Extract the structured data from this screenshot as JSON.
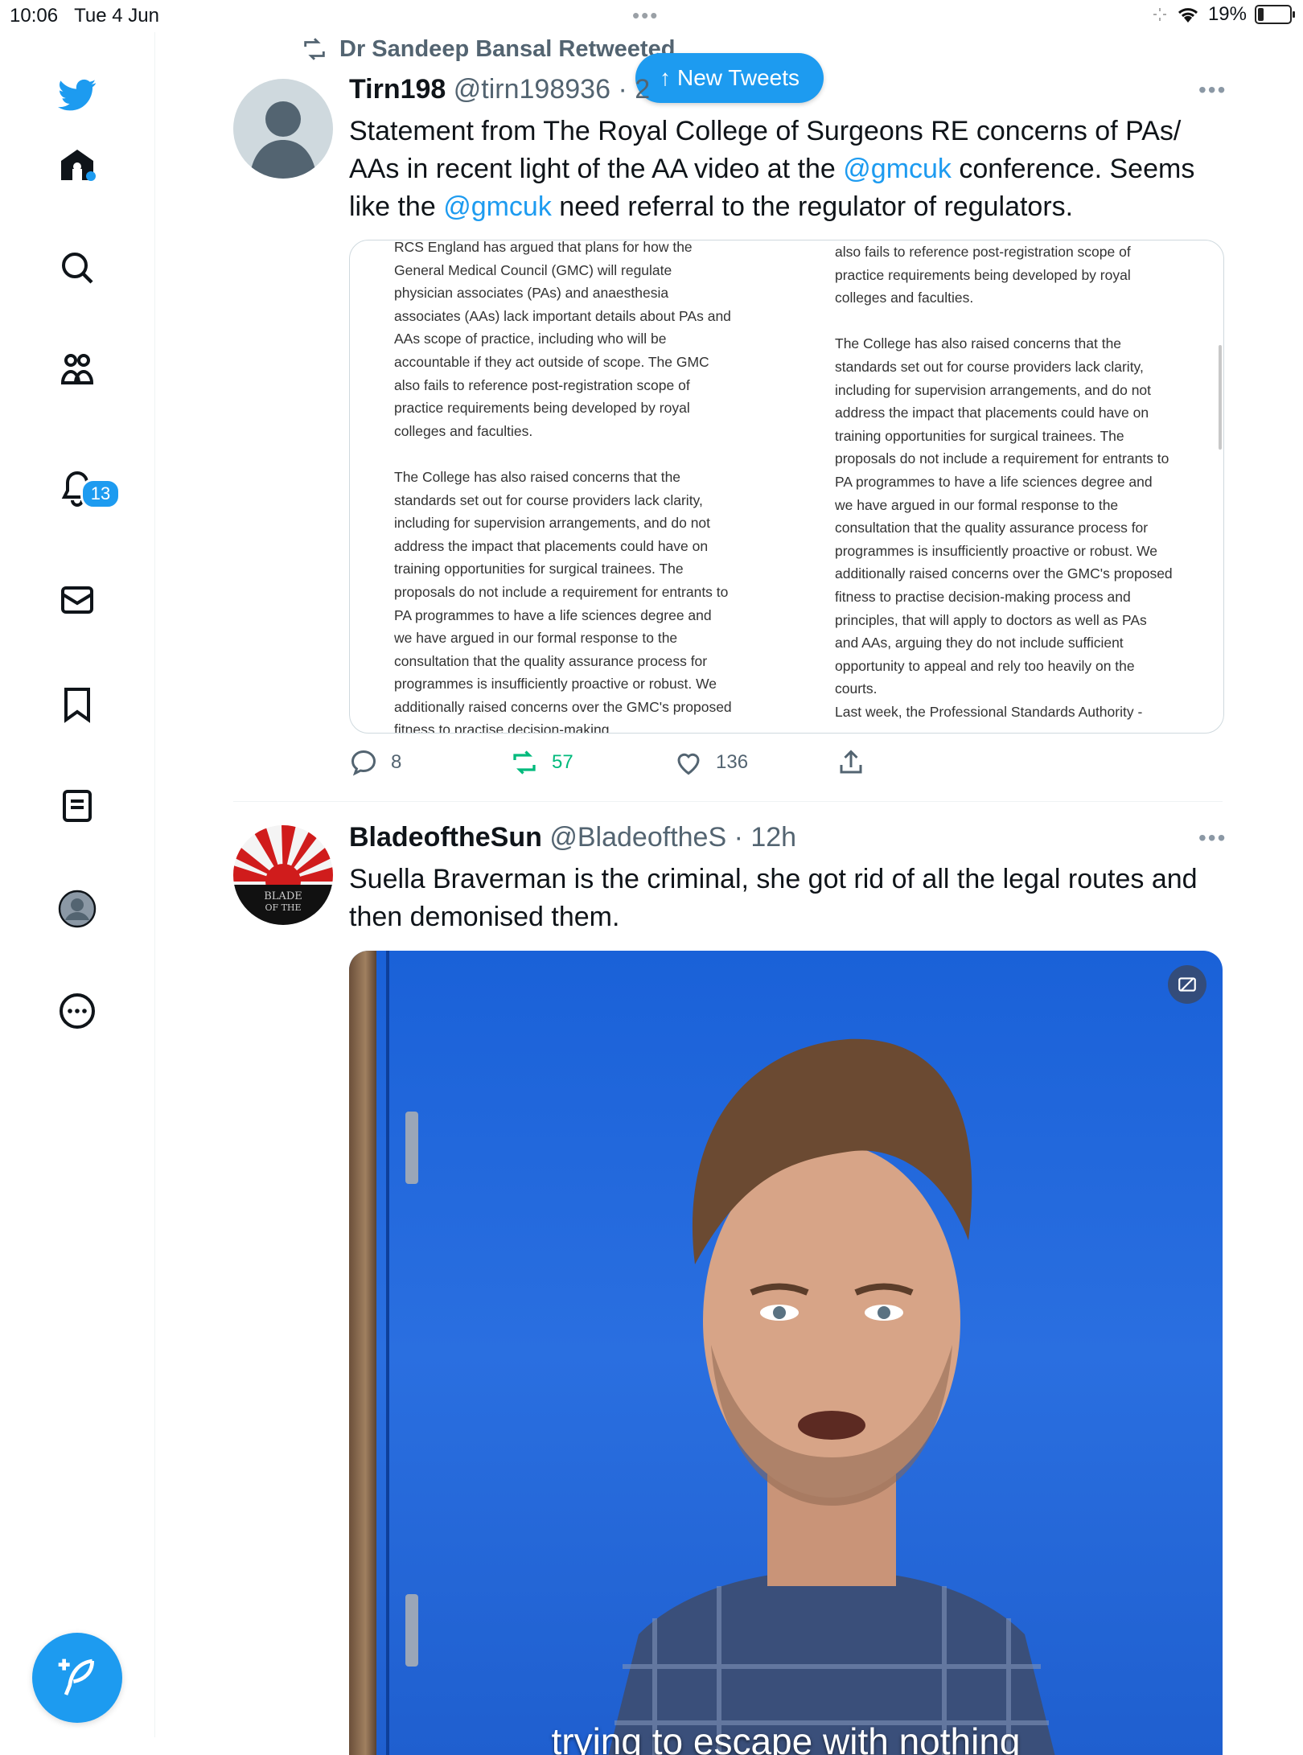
{
  "status_bar": {
    "time": "10:06",
    "date": "Tue 4 Jun",
    "battery": "19%",
    "battery_level": 0.19
  },
  "sidebar": {
    "items": [
      {
        "icon": "twitter-bird-icon"
      },
      {
        "icon": "home-icon"
      },
      {
        "icon": "search-icon"
      },
      {
        "icon": "communities-icon"
      },
      {
        "icon": "bell-icon",
        "badge": "13"
      },
      {
        "icon": "mail-icon"
      },
      {
        "icon": "bookmark-icon"
      },
      {
        "icon": "lists-icon"
      },
      {
        "icon": "profile-avatar"
      },
      {
        "icon": "more-circle-icon"
      }
    ],
    "compose_icon": "feather-plus-icon"
  },
  "new_tweets": {
    "label": "New Tweets"
  },
  "tweet1": {
    "retweeted_by": "Dr Sandeep Bansal Retweeted",
    "name": "Tirn198",
    "handle": "@tirn198936",
    "time_sep": "· 2",
    "text_part1": "Statement from The Royal College of Surgeons RE concerns of  PAs/ AAs in recent light of the AA video at the ",
    "mention1": "@gmcuk",
    "text_part2": " conference. Seems like the ",
    "mention2": "@gmcuk",
    "text_part3": "  need referral to the regulator of regulators.",
    "doc_left": "RCS England has argued that plans for how the General Medical Council (GMC) will regulate physician associates (PAs) and anaesthesia associates (AAs) lack important details about PAs and AAs scope of practice, including who will be accountable if they act outside of scope. The GMC also fails to reference post-registration scope of practice requirements being developed by royal colleges and faculties.\n\nThe College has also raised concerns that the standards set out for course providers lack clarity, including for supervision arrangements, and do not address the impact that placements could have on training opportunities for surgical trainees. The proposals do not include a requirement for entrants to PA programmes to have a life sciences degree and we have argued in our formal response to the consultation that the quality assurance process for programmes is insufficiently proactive or robust. We additionally raised concerns over the GMC's proposed fitness to practise decision-making",
    "doc_right": "also fails to reference post-registration scope of practice requirements being developed by royal colleges and faculties.\n\nThe College has also raised concerns that the standards set out for course providers lack clarity, including for supervision arrangements, and do not address the impact that placements could have on training opportunities for surgical trainees. The proposals do not include a requirement for entrants to PA programmes to have a life sciences degree and we have argued in our formal response to the consultation that the quality assurance process for programmes is insufficiently proactive or robust. We additionally raised concerns over the GMC's proposed fitness to practise decision-making process and principles, that will apply to doctors as well as PAs and AAs, arguing they do not include sufficient opportunity to appeal and rely too heavily on the courts.\nLast week, the Professional Standards Authority -",
    "replies": "8",
    "retweets": "57",
    "likes": "136"
  },
  "tweet2": {
    "name": "BladeoftheSun",
    "handle": "@BladeoftheS",
    "time": "· 12h",
    "text": "Suella Braverman is the criminal, she got rid of all the legal routes and then demonised them.",
    "avatar_text": "BLADE OF THE",
    "video_caption": "trying to escape with nothing"
  },
  "colors": {
    "accent": "#1d9bf0",
    "retweet_green": "#00ba7c",
    "muted": "#536471"
  }
}
